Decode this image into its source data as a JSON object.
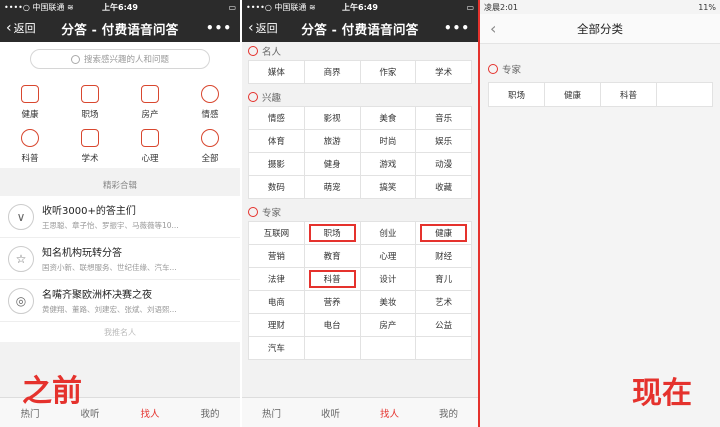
{
  "panel_before": {
    "status": {
      "carrier": "••••○ 中国联通 ≋",
      "time": "上午6:49"
    },
    "nav": {
      "back": "返回",
      "title": "分答 - 付费语音问答",
      "more": "•••"
    },
    "search_placeholder": "搜索感兴趣的人和问题",
    "categories": [
      "健康",
      "职场",
      "房产",
      "情感",
      "科普",
      "学术",
      "心理",
      "全部"
    ],
    "section_label": "精彩合辑",
    "features": [
      {
        "title": "收听3000+的答主们",
        "sub": "王思聪、章子怡、罗振宇、马薇薇等10..."
      },
      {
        "title": "知名机构玩转分答",
        "sub": "国资小新、联想服务、世纪佳缘、汽车..."
      },
      {
        "title": "名嘴齐聚欧洲杯决赛之夜",
        "sub": "黄健翔、董路、刘建宏、张斌、刘语熙..."
      }
    ],
    "more_label": "我推名人",
    "tabs": [
      "热门",
      "收听",
      "找人",
      "我的"
    ],
    "active_tab": "找人"
  },
  "panel_middle": {
    "status": {
      "carrier": "••••○ 中国联通 ≋",
      "time": "上午6:49"
    },
    "nav": {
      "back": "返回",
      "title": "分答 - 付费语音问答",
      "more": "•••"
    },
    "groups": [
      {
        "name": "名人",
        "items": [
          "媒体",
          "商界",
          "作家",
          "学术"
        ],
        "highlight": []
      },
      {
        "name": "兴趣",
        "items": [
          "情感",
          "影视",
          "美食",
          "音乐",
          "体育",
          "旅游",
          "时尚",
          "娱乐",
          "摄影",
          "健身",
          "游戏",
          "动漫",
          "数码",
          "萌宠",
          "搞笑",
          "收藏"
        ],
        "highlight": []
      },
      {
        "name": "专家",
        "items": [
          "互联网",
          "职场",
          "创业",
          "健康",
          "营销",
          "教育",
          "心理",
          "财经",
          "法律",
          "科普",
          "设计",
          "育儿",
          "电商",
          "营养",
          "美妆",
          "艺术",
          "理财",
          "电台",
          "房产",
          "公益",
          "汽车",
          "",
          "",
          ""
        ],
        "highlight": [
          1,
          3,
          9
        ]
      }
    ],
    "tabs": [
      "热门",
      "收听",
      "找人",
      "我的"
    ],
    "active_tab": "找人"
  },
  "panel_after": {
    "status": {
      "time": "凌晨2:01",
      "battery": "11%"
    },
    "nav": {
      "title": "全部分类"
    },
    "group": {
      "name": "专家",
      "items": [
        "职场",
        "健康",
        "科普",
        ""
      ]
    }
  },
  "labels": {
    "before": "之前",
    "now": "现在"
  },
  "colors": {
    "accent": "#e5322d",
    "navbar": "#2b2b2b"
  }
}
